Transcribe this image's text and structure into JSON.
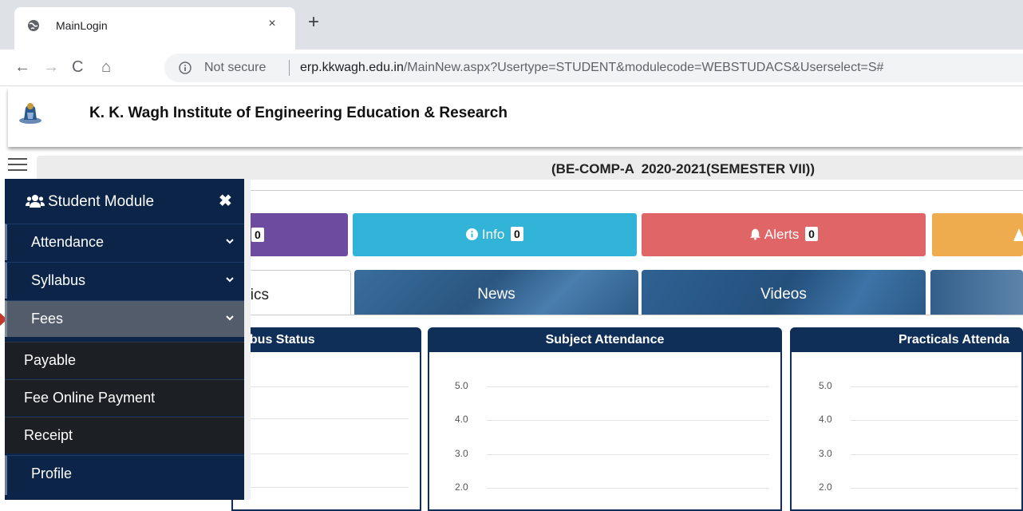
{
  "browser": {
    "tab_title": "MainLogin",
    "tab_close": "×",
    "new_tab": "+",
    "nav": {
      "back": "←",
      "forward": "→",
      "reload": "C",
      "home": "⌂"
    },
    "security_label": "Not secure",
    "url_host": "erp.kkwagh.edu.in",
    "url_path": "/MainNew.aspx?Usertype=STUDENT&modulecode=WEBSTUDACS&Userselect=S#"
  },
  "header": {
    "institute_name": "K. K. Wagh Institute of Engineering Education & Research",
    "class_info": "(BE-COMP-A  2020-2021(SEMESTER VII))"
  },
  "tiles": [
    {
      "name": "purple",
      "label": "",
      "count": "0",
      "color": "#6d4c9f"
    },
    {
      "name": "info",
      "label": "Info",
      "count": "0",
      "color": "#32b4d8"
    },
    {
      "name": "alerts",
      "label": "Alerts",
      "count": "0",
      "color": "#e06566"
    },
    {
      "name": "orange",
      "label": "",
      "count": "",
      "color": "#efac4e"
    }
  ],
  "tabs": {
    "analytics": "ytics",
    "news": "News",
    "videos": "Videos"
  },
  "panels": {
    "syllabus": {
      "title": "abus Status"
    },
    "subject_attendance": {
      "title": "Subject Attendance",
      "yticks": [
        "5.0",
        "4.0",
        "3.0",
        "2.0"
      ]
    },
    "practicals_attendance": {
      "title": "Practicals Attenda",
      "yticks": [
        "5.0",
        "4.0",
        "3.0",
        "2.0"
      ]
    }
  },
  "sidebar": {
    "title": "Student Module",
    "close": "✖",
    "items": {
      "attendance": "Attendance",
      "syllabus": "Syllabus",
      "fees": "Fees",
      "profile": "Profile"
    },
    "fees_submenu": {
      "payable": "Payable",
      "fee_online_payment": "Fee Online Payment",
      "receipt": "Receipt"
    }
  },
  "colors": {
    "sidebar_bg": "#0b2447",
    "panel_header": "#0f2f58",
    "tab_bg": "#2c5b88"
  }
}
